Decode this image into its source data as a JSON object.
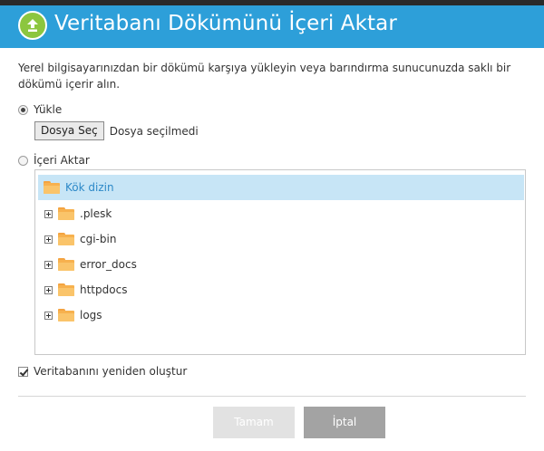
{
  "dialog": {
    "title": "Veritabanı Dökümünü İçeri Aktar",
    "description": "Yerel bilgisayarınızdan bir dökümü karşıya yükleyin veya barındırma sunucunuzda saklı bir dökümü içerir alın."
  },
  "upload_option": {
    "label": "Yükle",
    "selected": true,
    "choose_file_button": "Dosya Seç",
    "file_status": "Dosya seçilmedi"
  },
  "import_option": {
    "label": "İçeri Aktar",
    "selected": false
  },
  "tree": {
    "root_label": "Kök dizin",
    "items": [
      {
        "label": ".plesk"
      },
      {
        "label": "cgi-bin"
      },
      {
        "label": "error_docs"
      },
      {
        "label": "httpdocs"
      },
      {
        "label": "logs"
      }
    ]
  },
  "recreate_option": {
    "label": "Veritabanını yeniden oluştur",
    "checked": true
  },
  "buttons": {
    "ok": "Tamam",
    "cancel": "İptal"
  },
  "colors": {
    "header": "#2d9fd9",
    "header_icon": "#8cc63f",
    "tree_selected": "#c7e5f6",
    "folder": "#f7b14e",
    "ok_disabled": "#e2e2e2",
    "cancel": "#a3a3a3"
  }
}
